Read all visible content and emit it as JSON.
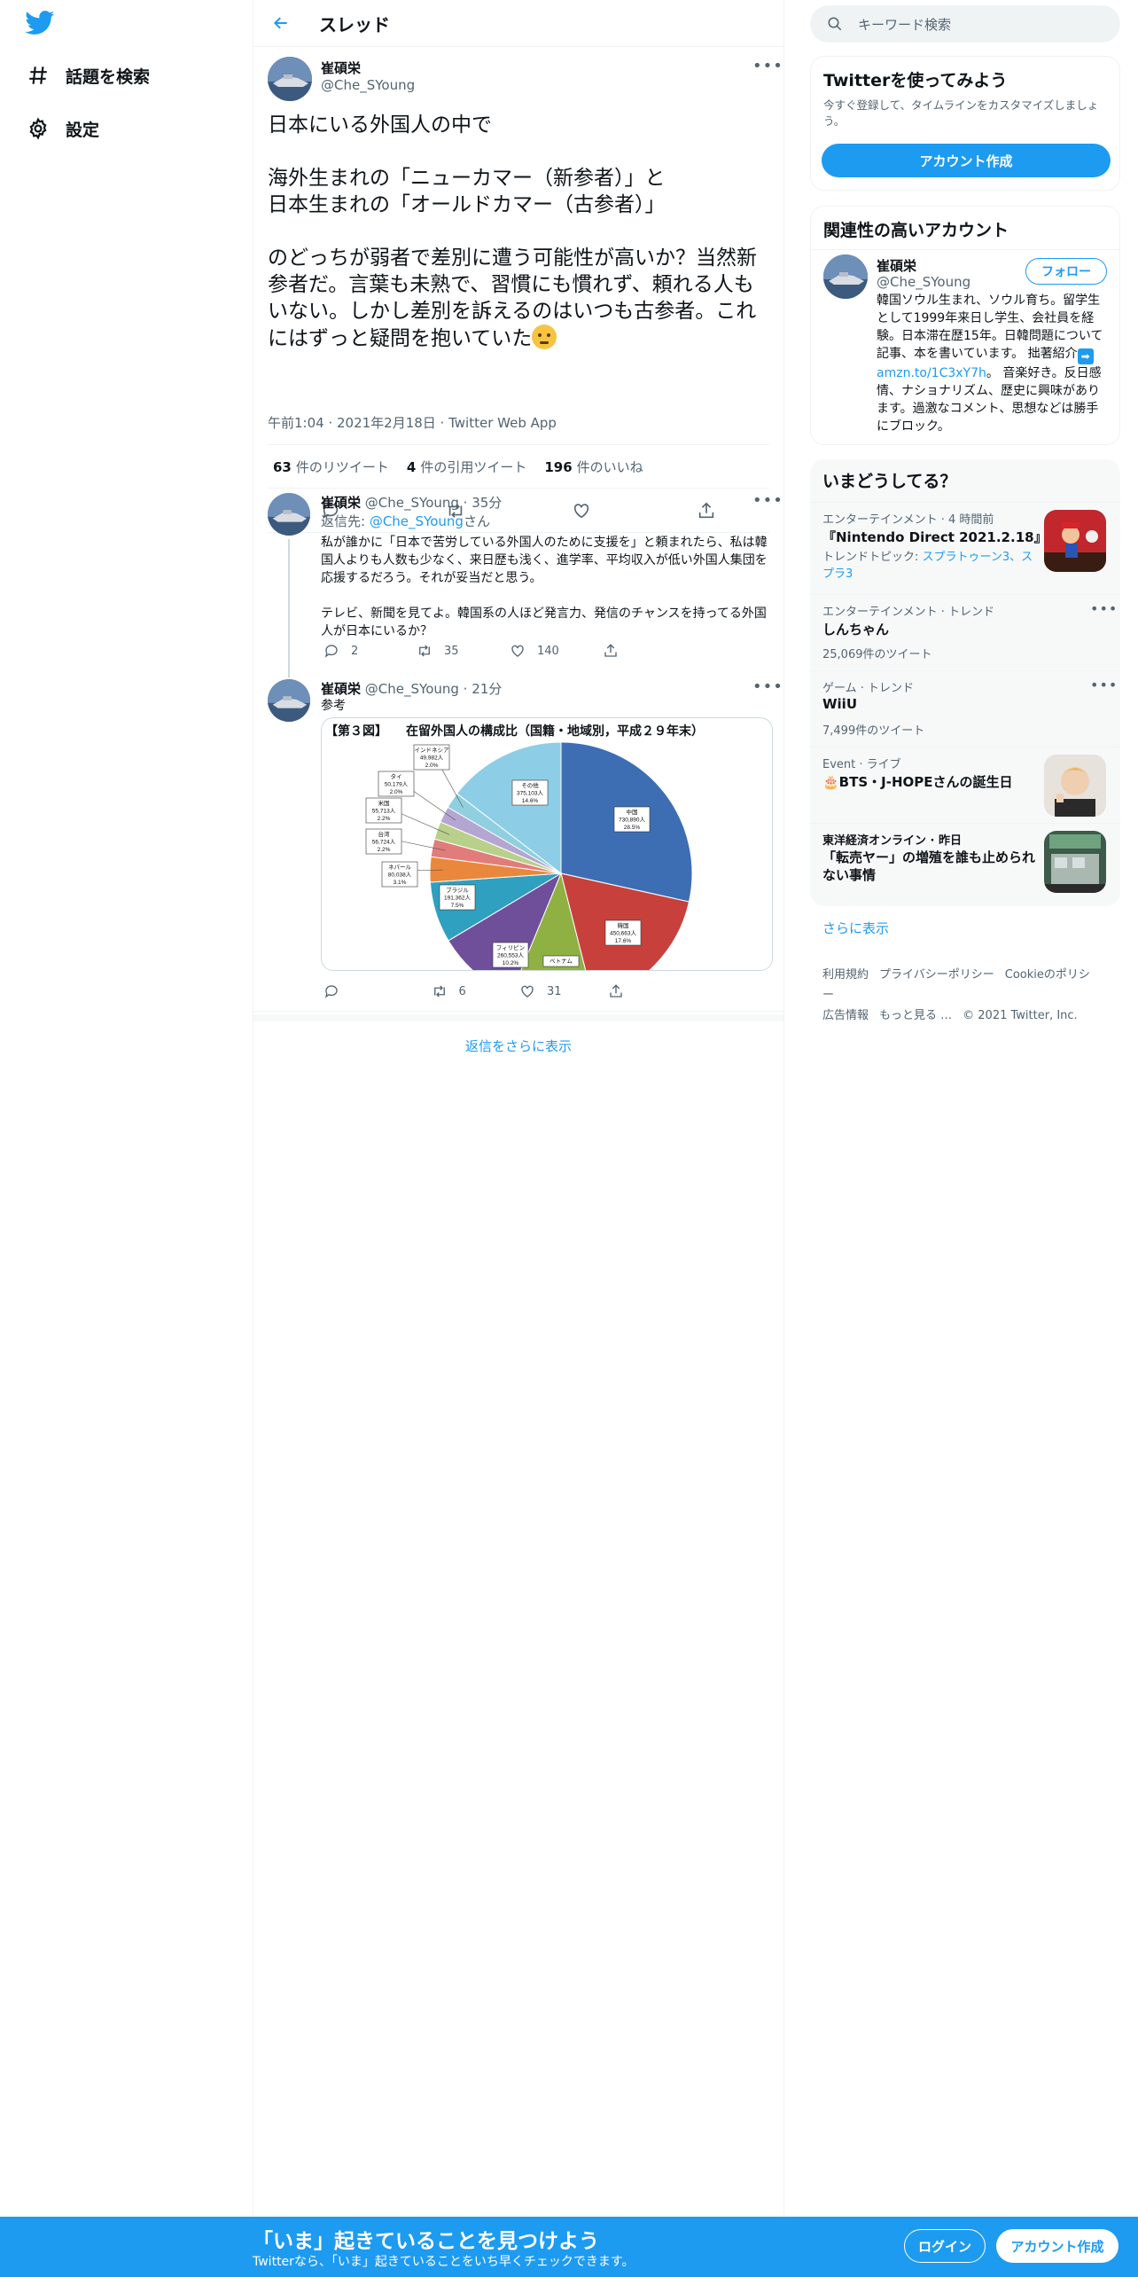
{
  "nav": {
    "explore": "話題を検索",
    "settings": "設定"
  },
  "header": {
    "title": "スレッド"
  },
  "main_tweet": {
    "name": "崔碩栄",
    "handle": "@Che_SYoung",
    "text": "日本にいる外国人の中で\n\n海外生まれの「ニューカマー（新参者）」と\n日本生まれの「オールドカマー（古参者）」\n\nのどっちが弱者で差別に遭う可能性が高いか？当然新参者だ。言葉も未熟で、習慣にも慣れず、頼れる人もいない。しかし差別を訴えるのはいつも古参者。これにはずっと疑問を抱いていた",
    "meta": "午前1:04 · 2021年2月18日 · Twitter Web App",
    "retweets_count": "63",
    "retweets_label": "件のリツイート",
    "quotes_count": "4",
    "quotes_label": "件の引用ツイート",
    "likes_count": "196",
    "likes_label": "件のいいね"
  },
  "reply1": {
    "name": "崔碩栄",
    "handle_time": "@Che_SYoung · 35分",
    "reply_prefix": "返信先: ",
    "reply_to": "@Che_SYoung",
    "reply_suffix": "さん",
    "text": "私が誰かに「日本で苦労している外国人のために支援を」と頼まれたら、私は韓国人よりも人数も少なく、来日歴も浅く、進学率、平均収入が低い外国人集団を応援するだろう。それが妥当だと思う。\n\nテレビ、新聞を見てよ。韓国系の人ほど発言力、発信のチャンスを持ってる外国人が日本にいるか？",
    "replies": "2",
    "retweets": "35",
    "likes": "140"
  },
  "reply2": {
    "name": "崔碩栄",
    "handle_time": "@Che_SYoung · 21分",
    "text": "参考",
    "replies": "",
    "retweets": "6",
    "likes": "31"
  },
  "chart_data": {
    "type": "pie",
    "title": "【第３図】　　在留外国人の構成比（国籍・地域別，平成２９年末）",
    "slices": [
      {
        "label": "中国",
        "count": "730,890人",
        "pct_label": "28.5%",
        "value": 28.5,
        "color": "#3d6eb4"
      },
      {
        "label": "韓国",
        "count": "450,663人",
        "pct_label": "17.6%",
        "value": 17.6,
        "color": "#c8403c"
      },
      {
        "label": "ベトナム",
        "count": "",
        "pct_label": "",
        "value": 10.2,
        "color": "#8fb144"
      },
      {
        "label": "フィリピン",
        "count": "260,553人",
        "pct_label": "10.2%",
        "value": 10.2,
        "color": "#6f4f9a"
      },
      {
        "label": "ブラジル",
        "count": "191,362人",
        "pct_label": "7.5%",
        "value": 7.5,
        "color": "#2fa0c0"
      },
      {
        "label": "ネパール",
        "count": "80,038人",
        "pct_label": "3.1%",
        "value": 3.1,
        "color": "#e9883c"
      },
      {
        "label": "台湾",
        "count": "56,724人",
        "pct_label": "2.2%",
        "value": 2.2,
        "color": "#e07d7a"
      },
      {
        "label": "米国",
        "count": "55,713人",
        "pct_label": "2.2%",
        "value": 2.2,
        "color": "#b9d08a"
      },
      {
        "label": "タイ",
        "count": "50,179人",
        "pct_label": "2.0%",
        "value": 2.0,
        "color": "#b4a6d1"
      },
      {
        "label": "インドネシア",
        "count": "49,982人",
        "pct_label": "2.0%",
        "value": 2.0,
        "color": "#8fcfe0"
      },
      {
        "label": "その他",
        "count": "375,103人",
        "pct_label": "14.6%",
        "value": 14.6,
        "color": "#8ecde6"
      }
    ]
  },
  "show_more_replies": "返信をさらに表示",
  "sidebar": {
    "search_placeholder": "キーワード検索",
    "signup_title": "Twitterを使ってみよう",
    "signup_sub": "今すぐ登録して、タイムラインをカスタマイズしましょう。",
    "signup_button": "アカウント作成",
    "related_title": "関連性の高いアカウント",
    "related_name": "崔碩栄",
    "related_handle": "@Che_SYoung",
    "follow_button": "フォロー",
    "bio_a": "韓国ソウル生まれ、ソウル育ち。留学生として1999年来日し学生、会社員を経験。日本滞在歴15年。日韓問題について記事、本を書いています。 拙著紹介",
    "bio_link": "amzn.to/1C3xY7h",
    "bio_b": "。 音楽好き。反日感情、ナショナリズム、歴史に興味があります。過激なコメント、思想などは勝手にブロック。",
    "trends_title": "いまどうしてる？",
    "trends": [
      {
        "context": "エンターテインメント · 4 時間前",
        "title": "『Nintendo Direct 2021.2.18』",
        "sub_prefix": "トレンドトピック: ",
        "sub_link": "スプラトゥーン3、スプラ3"
      },
      {
        "context": "エンターテインメント · トレンド",
        "title": "しんちゃん",
        "sub": "25,069件のツイート"
      },
      {
        "context": "ゲーム · トレンド",
        "title": "WiiU",
        "sub": "7,499件のツイート"
      },
      {
        "context": "Event · ライブ",
        "title": "🎂BTS・J-HOPEさんの誕生日"
      },
      {
        "context": "東洋経済オンライン · 昨日",
        "title": "「転売ヤー」の増殖を誰も止められない事情"
      }
    ],
    "show_more": "さらに表示",
    "footer": [
      "利用規約",
      "プライバシーポリシー",
      "Cookieのポリシー",
      "広告情報",
      "もっと見る …",
      "© 2021 Twitter, Inc."
    ]
  },
  "bottom_bar": {
    "title": "「いま」起きていることを見つけよう",
    "sub": "Twitterなら、「いま」起きていることをいち早くチェックできます。",
    "login": "ログイン",
    "signup": "アカウント作成"
  }
}
